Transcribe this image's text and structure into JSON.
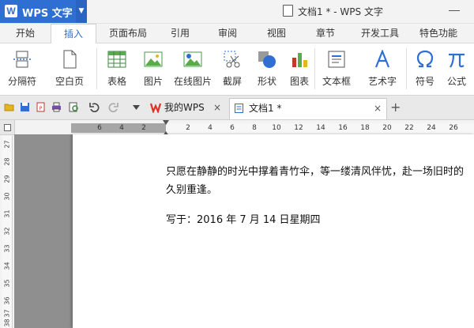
{
  "app": {
    "name": "WPS 文字",
    "logo_letter": "W",
    "window_title": "文档1 * - WPS 文字"
  },
  "ribbon_tabs": [
    "开始",
    "插入",
    "页面布局",
    "引用",
    "审阅",
    "视图",
    "章节",
    "开发工具",
    "特色功能"
  ],
  "active_tab": "插入",
  "ribbon": {
    "page_break": "分隔符",
    "blank_page": "空白页",
    "table": "表格",
    "picture": "图片",
    "online_picture": "在线图片",
    "screenshot": "截屏",
    "shapes": "形状",
    "chart": "图表",
    "textbox": "文本框",
    "wordart": "艺术字",
    "symbol": "符号",
    "formula": "公式"
  },
  "doc_tabs": {
    "wps": "我的WPS",
    "doc": "文档1 *"
  },
  "ruler": {
    "h_ticks": [
      "6",
      "4",
      "2",
      "2",
      "4",
      "6",
      "8",
      "10",
      "12",
      "14",
      "16",
      "18",
      "20",
      "22",
      "24",
      "26"
    ],
    "v_ticks": [
      "27",
      "28",
      "29",
      "30",
      "31",
      "32",
      "33",
      "34",
      "35",
      "36",
      "37",
      "38"
    ]
  },
  "document": {
    "line1": "只愿在静静的时光中撑着青竹伞，等一缕清风伴忧，赴一场旧时的",
    "line2": "久别重逢。",
    "line3": "写于：2016 年 7 月 14 日星期四"
  },
  "colors": {
    "accent": "#2f6fd3",
    "wps_red": "#d9342b"
  }
}
